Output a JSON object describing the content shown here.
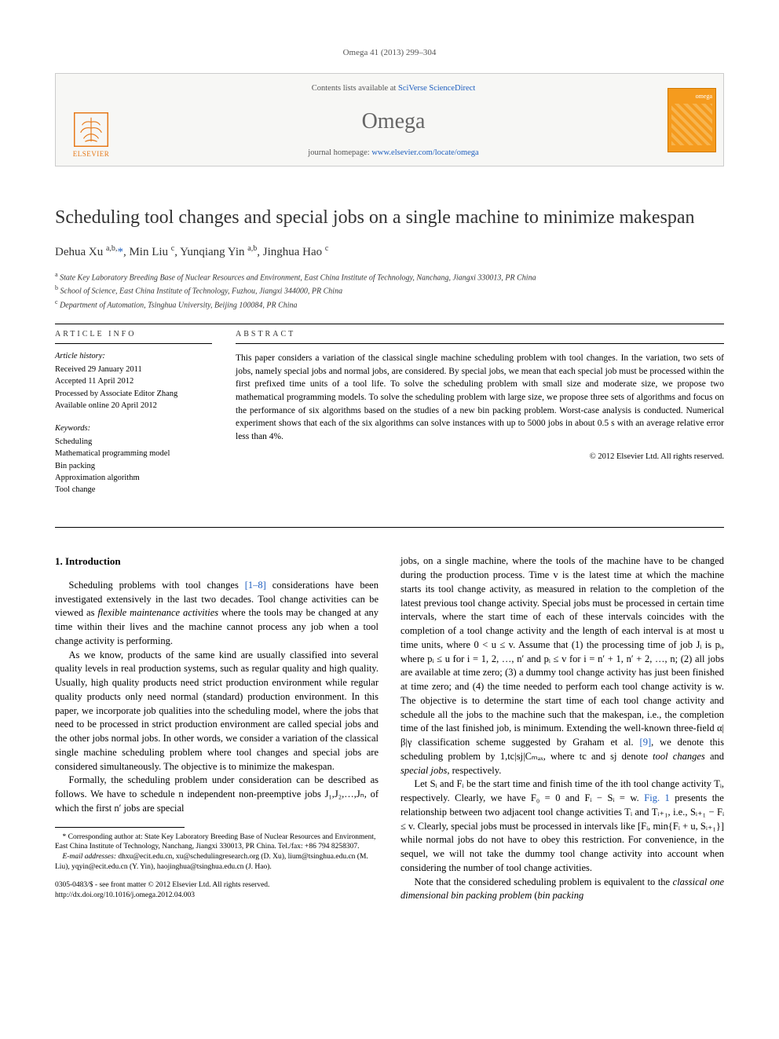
{
  "citation": "Omega 41 (2013) 299–304",
  "masthead": {
    "contents_prefix": "Contents lists available at ",
    "contents_link": "SciVerse ScienceDirect",
    "journal": "Omega",
    "homepage_prefix": "journal homepage: ",
    "homepage_link": "www.elsevier.com/locate/omega",
    "publisher": "ELSEVIER",
    "cover_label": "omega"
  },
  "title": "Scheduling tool changes and special jobs on a single machine to minimize makespan",
  "authors_html": "Dehua Xu <sup>a,b,</sup><a>*</a>, Min Liu <sup>c</sup>, Yunqiang Yin <sup>a,b</sup>, Jinghua Hao <sup>c</sup>",
  "affiliations": [
    {
      "sup": "a",
      "text": "State Key Laboratory Breeding Base of Nuclear Resources and Environment, East China Institute of Technology, Nanchang, Jiangxi 330013, PR China"
    },
    {
      "sup": "b",
      "text": "School of Science, East China Institute of Technology, Fuzhou, Jiangxi 344000, PR China"
    },
    {
      "sup": "c",
      "text": "Department of Automation, Tsinghua University, Beijing 100084, PR China"
    }
  ],
  "article_info": {
    "heading": "ARTICLE INFO",
    "history_label": "Article history:",
    "history": [
      "Received 29 January 2011",
      "Accepted 11 April 2012",
      "Processed by Associate Editor Zhang",
      "Available online 20 April 2012"
    ],
    "keywords_label": "Keywords:",
    "keywords": [
      "Scheduling",
      "Mathematical programming model",
      "Bin packing",
      "Approximation algorithm",
      "Tool change"
    ]
  },
  "abstract": {
    "heading": "ABSTRACT",
    "text": "This paper considers a variation of the classical single machine scheduling problem with tool changes. In the variation, two sets of jobs, namely special jobs and normal jobs, are considered. By special jobs, we mean that each special job must be processed within the first prefixed time units of a tool life. To solve the scheduling problem with small size and moderate size, we propose two mathematical programming models. To solve the scheduling problem with large size, we propose three sets of algorithms and focus on the performance of six algorithms based on the studies of a new bin packing problem. Worst-case analysis is conducted. Numerical experiment shows that each of the six algorithms can solve instances with up to 5000 jobs in about 0.5 s with an average relative error less than 4%.",
    "copyright": "© 2012 Elsevier Ltd. All rights reserved."
  },
  "body": {
    "section_number": "1.",
    "section_title": "Introduction",
    "p1": "Scheduling problems with tool changes [1–8] considerations have been investigated extensively in the last two decades. Tool change activities can be viewed as flexible maintenance activities where the tools may be changed at any time within their lives and the machine cannot process any job when a tool change activity is performing.",
    "p2": "As we know, products of the same kind are usually classified into several quality levels in real production systems, such as regular quality and high quality. Usually, high quality products need strict production environment while regular quality products only need normal (standard) production environment. In this paper, we incorporate job qualities into the scheduling model, where the jobs that need to be processed in strict production environment are called special jobs and the other jobs normal jobs. In other words, we consider a variation of the classical single machine scheduling problem where tool changes and special jobs are considered simultaneously. The objective is to minimize the makespan.",
    "p3": "Formally, the scheduling problem under consideration can be described as follows. We have to schedule n independent non-preemptive jobs J₁,J₂,…,Jₙ, of which the first n′ jobs are special",
    "p4": "jobs, on a single machine, where the tools of the machine have to be changed during the production process. Time v is the latest time at which the machine starts its tool change activity, as measured in relation to the completion of the latest previous tool change activity. Special jobs must be processed in certain time intervals, where the start time of each of these intervals coincides with the completion of a tool change activity and the length of each interval is at most u time units, where 0 < u ≤ v. Assume that (1) the processing time of job Jᵢ is pᵢ, where pᵢ ≤ u for i = 1, 2, …, n′ and pᵢ ≤ v for i = n′ + 1, n′ + 2, …, n; (2) all jobs are available at time zero; (3) a dummy tool change activity has just been finished at time zero; and (4) the time needed to perform each tool change activity is w. The objective is to determine the start time of each tool change activity and schedule all the jobs to the machine such that the makespan, i.e., the completion time of the last finished job, is minimum. Extending the well-known three-field α|β|γ classification scheme suggested by Graham et al. [9], we denote this scheduling problem by 1,tc|sj|Cₘₐₓ, where tc and sj denote tool changes and special jobs, respectively.",
    "p5": "Let Sᵢ and Fᵢ be the start time and finish time of the ith tool change activity Tᵢ, respectively. Clearly, we have F₀ = 0 and Fᵢ − Sᵢ = w. Fig. 1 presents the relationship between two adjacent tool change activities Tᵢ and Tᵢ₊₁, i.e., Sᵢ₊₁ − Fᵢ ≤ v. Clearly, special jobs must be processed in intervals like [Fᵢ, min{Fᵢ + u, Sᵢ₊₁}] while normal jobs do not have to obey this restriction. For convenience, in the sequel, we will not take the dummy tool change activity into account when considering the number of tool change activities.",
    "p6": "Note that the considered scheduling problem is equivalent to the classical one dimensional bin packing problem (bin packing"
  },
  "footnotes": {
    "corr_label": "* Corresponding author at: ",
    "corr_text": "State Key Laboratory Breeding Base of Nuclear Resources and Environment, East China Institute of Technology, Nanchang, Jiangxi 330013, PR China. Tel./fax: +86 794 8258307.",
    "email_label": "E-mail addresses: ",
    "emails": "dhxu@ecit.edu.cn, xu@schedulingresearch.org (D. Xu), lium@tsinghua.edu.cn (M. Liu), yqyin@ecit.edu.cn (Y. Yin), haojinghua@tsinghua.edu.cn (J. Hao)."
  },
  "doi": {
    "line1": "0305-0483/$ - see front matter © 2012 Elsevier Ltd. All rights reserved.",
    "line2": "http://dx.doi.org/10.1016/j.omega.2012.04.003"
  },
  "refs": {
    "r1_8": "[1–8]",
    "r9": "[9]",
    "fig1": "Fig. 1"
  }
}
